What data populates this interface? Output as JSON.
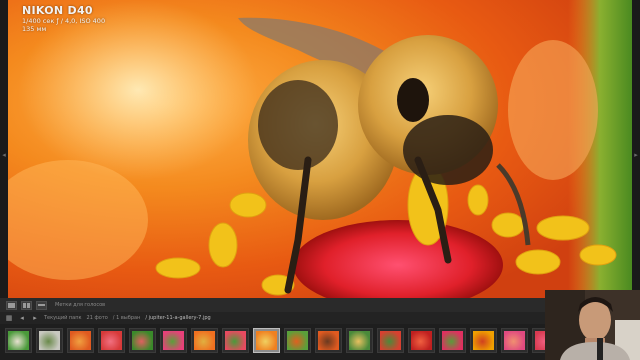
{
  "photo_info": {
    "camera": "NIKON D40",
    "exposure": "1/400 сек  ƒ / 4,0, ISO 400",
    "lens": "135 мм"
  },
  "toolbar": {
    "hint": "Метки для голосов"
  },
  "filmstrip_header": {
    "breadcrumb_1": "Текущий папк",
    "count": "21 фото",
    "count_detail": "/ 1 выбран",
    "file_name": "/ jupiter-11-a-gallery-7.jpg"
  },
  "thumbnails": [
    {
      "c1": "#4a9a3a",
      "c2": "#e8e0d0"
    },
    {
      "c1": "#c8c8c0",
      "c2": "#6a8a4a"
    },
    {
      "c1": "#e05a20",
      "c2": "#f0a040"
    },
    {
      "c1": "#d83a3a",
      "c2": "#f07080"
    },
    {
      "c1": "#3a8a2a",
      "c2": "#e06060"
    },
    {
      "c1": "#e8407a",
      "c2": "#5aa03a"
    },
    {
      "c1": "#f07020",
      "c2": "#e0b040"
    },
    {
      "c1": "#e84a60",
      "c2": "#4a9a3a"
    },
    {
      "c1": "#f08020",
      "c2": "#f0d060"
    },
    {
      "c1": "#5aa03a",
      "c2": "#e06020"
    },
    {
      "c1": "#e05a20",
      "c2": "#6a3a20"
    },
    {
      "c1": "#4a8a3a",
      "c2": "#e8c060"
    },
    {
      "c1": "#d84030",
      "c2": "#4a8a3a"
    },
    {
      "c1": "#c02020",
      "c2": "#f06040"
    },
    {
      "c1": "#e03060",
      "c2": "#5a9a3a"
    },
    {
      "c1": "#f0a000",
      "c2": "#d04020"
    },
    {
      "c1": "#e04a80",
      "c2": "#f09070"
    },
    {
      "c1": "#d83a50",
      "c2": "#f06080"
    }
  ],
  "selected_thumb": 8
}
